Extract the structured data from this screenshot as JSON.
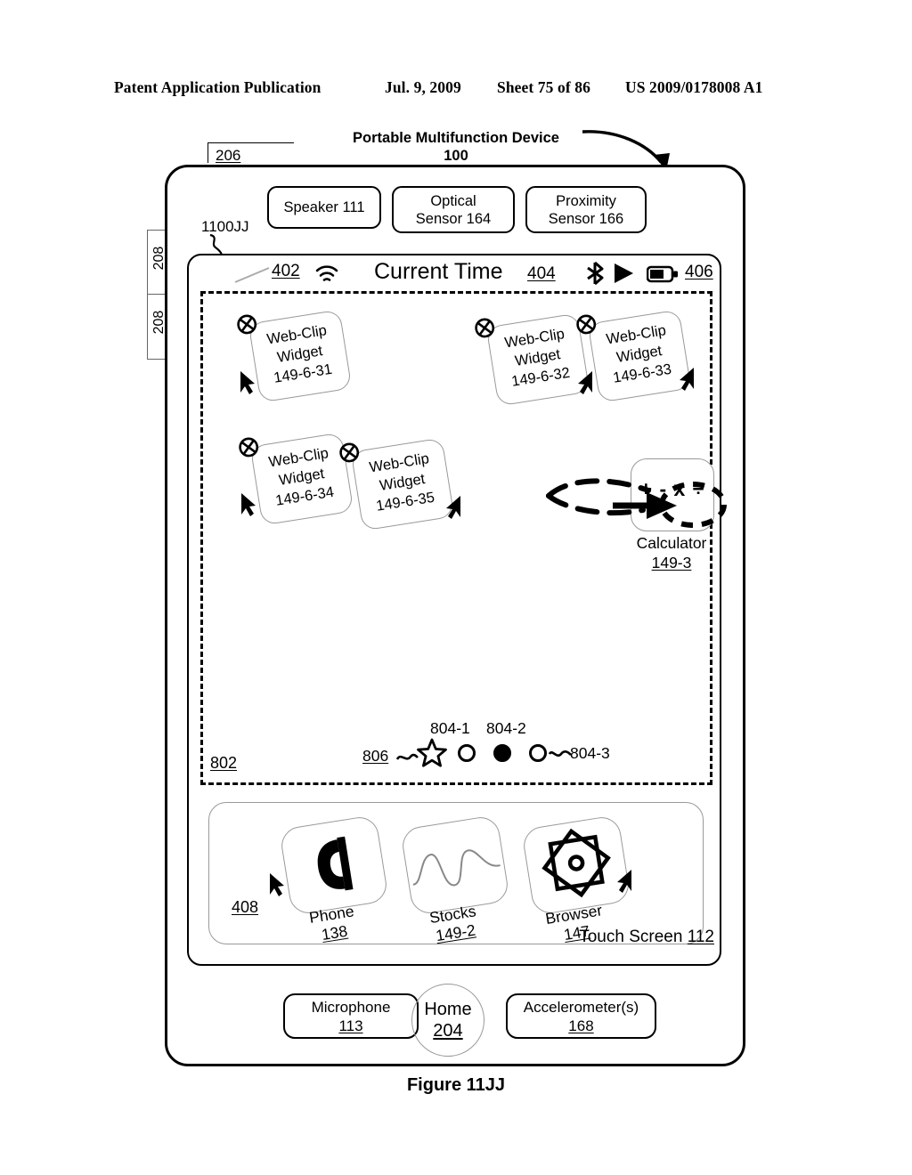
{
  "page_header": {
    "publication": "Patent Application Publication",
    "date": "Jul. 9, 2009",
    "sheet": "Sheet 75 of 86",
    "patent_number": "US 2009/0178008 A1"
  },
  "figure": {
    "caption": "Figure 11JJ",
    "device_title": "Portable Multifunction Device",
    "device_ref": "100",
    "ui_state_ref": "1100JJ",
    "top_speaker_ref": "206",
    "side_button_ref": "208",
    "touch_screen_label": "Touch Screen",
    "touch_screen_ref": "112"
  },
  "sensors": [
    {
      "name": "sensor-speaker",
      "label": "Speaker",
      "ref": "111",
      "lines": [
        "Speaker 111"
      ]
    },
    {
      "name": "sensor-optical",
      "label": "Optical Sensor",
      "ref": "164",
      "line1": "Optical",
      "line2": "Sensor 164"
    },
    {
      "name": "sensor-proximity",
      "label": "Proximity Sensor",
      "ref": "166",
      "line1": "Proximity",
      "line2": "Sensor 166"
    }
  ],
  "status_bar": {
    "signal_ref": "402",
    "time_label": "Current Time",
    "time_ref": "404",
    "battery_ref": "406",
    "icons": [
      "signal-bars-icon",
      "wifi-icon",
      "bluetooth-icon",
      "play-icon",
      "battery-icon"
    ]
  },
  "widget_area": {
    "ref": "802",
    "widgets": [
      {
        "line1": "Web-Clip",
        "line2": "Widget",
        "line3": "149-6-31",
        "pointer": "left"
      },
      {
        "line1": "Web-Clip",
        "line2": "Widget",
        "line3": "149-6-32",
        "pointer": "right"
      },
      {
        "line1": "Web-Clip",
        "line2": "Widget",
        "line3": "149-6-33",
        "pointer": "right"
      },
      {
        "line1": "Web-Clip",
        "line2": "Widget",
        "line3": "149-6-34",
        "pointer": "left"
      },
      {
        "line1": "Web-Clip",
        "line2": "Widget",
        "line3": "149-6-35",
        "pointer": "right"
      }
    ],
    "calculator": {
      "label": "Calculator",
      "ref": "149-3",
      "symbols": "+ - x ÷"
    }
  },
  "pagination": {
    "indicator_ref": "806",
    "dot_labels": [
      "804-1",
      "804-2",
      "804-3"
    ],
    "active_index": 1
  },
  "dock": {
    "ref": "408",
    "apps": [
      {
        "label": "Phone",
        "ref": "138",
        "icon": "phone-handset-icon",
        "pointer": "left"
      },
      {
        "label": "Stocks",
        "ref": "149-2",
        "icon": "stocks-wave-icon",
        "pointer": "none"
      },
      {
        "label": "Browser",
        "ref": "147",
        "icon": "browser-compass-icon",
        "pointer": "right"
      }
    ]
  },
  "bottom_controls": [
    {
      "name": "microphone",
      "label": "Microphone",
      "ref": "113"
    },
    {
      "name": "home-button",
      "label": "Home",
      "ref": "204"
    },
    {
      "name": "accelerometers",
      "label": "Accelerometer(s)",
      "ref": "168"
    }
  ]
}
